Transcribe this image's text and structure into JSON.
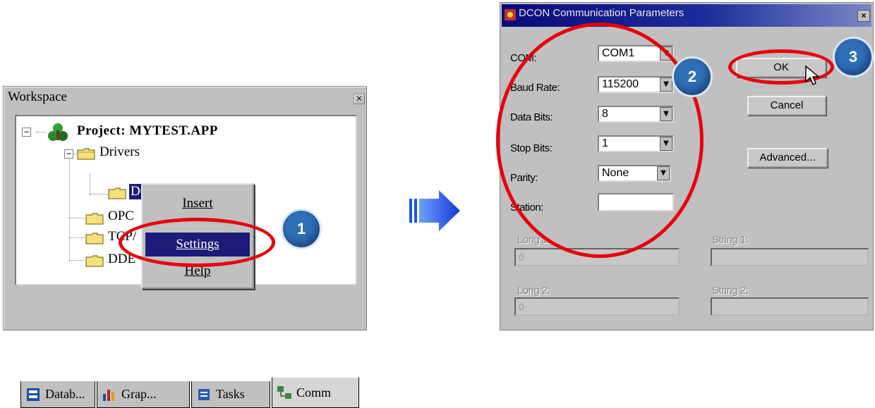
{
  "workspace": {
    "title": "Workspace",
    "close_glyph": "×",
    "tree": {
      "project": "Project: MYTEST.APP",
      "drivers": "Drivers",
      "dcon": "DCON",
      "opc": "OPC",
      "tcp": "TCP/",
      "dde": "DDE"
    },
    "context_menu": [
      "Insert",
      "Settings",
      "Help"
    ],
    "tabs": [
      "Datab...",
      "Grap...",
      "Tasks",
      "Comm"
    ]
  },
  "dialog": {
    "title": "DCON Communication Parameters",
    "close_glyph": "×",
    "fields": {
      "com_label": "COM:",
      "com_value": "COM1",
      "baud_label": "Baud Rate:",
      "baud_value": "115200",
      "data_label": "Data Bits:",
      "data_value": "8",
      "stop_label": "Stop Bits:",
      "stop_value": "1",
      "parity_label": "Parity:",
      "parity_value": "None",
      "station_label": "Station:",
      "long1_label": "Long 1:",
      "long1_value": "0",
      "long2_label": "Long 2:",
      "long2_value": "0",
      "string1_label": "String 1:",
      "string2_label": "String 2:"
    },
    "buttons": {
      "ok": "OK",
      "cancel": "Cancel",
      "advanced": "Advanced..."
    }
  },
  "annotations": {
    "step1": "1",
    "step2": "2",
    "step3": "3"
  },
  "colors": {
    "highlight_ring": "#e8000d",
    "badge": "#2e6fb5",
    "arrow": "#1a56e0",
    "titlebar": "#0a0a7a"
  },
  "icons": [
    "close-icon",
    "project-icon",
    "folder-icon",
    "chevron-down-icon",
    "arrow-right-icon",
    "cursor-icon"
  ]
}
